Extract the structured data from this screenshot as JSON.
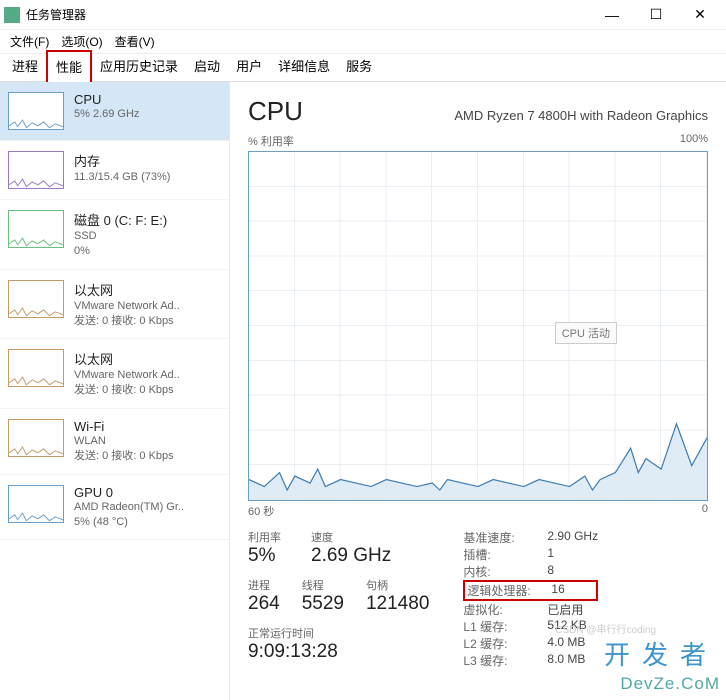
{
  "window": {
    "title": "任务管理器"
  },
  "menu": {
    "file": "文件(F)",
    "options": "选项(O)",
    "view": "查看(V)"
  },
  "tabs": {
    "items": [
      "进程",
      "性能",
      "应用历史记录",
      "启动",
      "用户",
      "详细信息",
      "服务"
    ],
    "active_index": 1
  },
  "sidebar": [
    {
      "name": "CPU",
      "sub1": "5% 2.69 GHz",
      "sub2": "",
      "thumb_color": "#6aa0c8",
      "selected": true
    },
    {
      "name": "内存",
      "sub1": "11.3/15.4 GB (73%)",
      "sub2": "",
      "thumb_color": "#9b79c5",
      "selected": false
    },
    {
      "name": "磁盘 0 (C: F: E:)",
      "sub1": "SSD",
      "sub2": "0%",
      "thumb_color": "#6bbf7a",
      "selected": false
    },
    {
      "name": "以太网",
      "sub1": "VMware Network Ad..",
      "sub2": "发送: 0 接收: 0 Kbps",
      "thumb_color": "#c69a6b",
      "selected": false
    },
    {
      "name": "以太网",
      "sub1": "VMware Network Ad..",
      "sub2": "发送: 0 接收: 0 Kbps",
      "thumb_color": "#c69a6b",
      "selected": false
    },
    {
      "name": "Wi-Fi",
      "sub1": "WLAN",
      "sub2": "发送: 0 接收: 0 Kbps",
      "thumb_color": "#c69a6b",
      "selected": false
    },
    {
      "name": "GPU 0",
      "sub1": "AMD Radeon(TM) Gr..",
      "sub2": "5% (48 °C)",
      "thumb_color": "#6aa0c8",
      "selected": false
    }
  ],
  "main": {
    "title": "CPU",
    "subtitle": "AMD Ryzen 7 4800H with Radeon Graphics",
    "axis_top_left": "% 利用率",
    "axis_top_right": "100%",
    "axis_bottom_left": "60 秒",
    "axis_bottom_right": "0",
    "chart_annotation": "CPU 活动",
    "stats_left": [
      {
        "label": "利用率",
        "value": "5%"
      },
      {
        "label": "速度",
        "value": "2.69 GHz"
      }
    ],
    "stats_mid": [
      {
        "label": "进程",
        "value": "264"
      },
      {
        "label": "线程",
        "value": "5529"
      },
      {
        "label": "句柄",
        "value": "121480"
      }
    ],
    "uptime_label": "正常运行时间",
    "uptime_value": "9:09:13:28",
    "stats_right": [
      {
        "k": "基准速度:",
        "v": "2.90 GHz"
      },
      {
        "k": "插槽:",
        "v": "1"
      },
      {
        "k": "内核:",
        "v": "8"
      },
      {
        "k": "逻辑处理器:",
        "v": "16",
        "hl": true
      },
      {
        "k": "虚拟化:",
        "v": "已启用"
      },
      {
        "k": "L1 缓存:",
        "v": "512 KB"
      },
      {
        "k": "L2 缓存:",
        "v": "4.0 MB"
      },
      {
        "k": "L3 缓存:",
        "v": "8.0 MB"
      }
    ]
  },
  "chart_data": {
    "type": "area",
    "title": "CPU 活动",
    "xlabel": "60 秒",
    "ylabel": "% 利用率",
    "xlim": [
      0,
      60
    ],
    "ylim": [
      0,
      100
    ],
    "x": [
      0,
      2,
      4,
      5,
      6,
      8,
      9,
      10,
      12,
      14,
      16,
      18,
      20,
      22,
      24,
      25,
      26,
      28,
      30,
      32,
      34,
      36,
      38,
      40,
      42,
      44,
      45,
      46,
      48,
      50,
      51,
      52,
      54,
      56,
      58,
      60
    ],
    "values": [
      6,
      4,
      8,
      3,
      7,
      5,
      9,
      4,
      6,
      5,
      4,
      6,
      5,
      4,
      5,
      3,
      6,
      5,
      4,
      6,
      5,
      4,
      6,
      5,
      4,
      7,
      3,
      6,
      8,
      15,
      8,
      12,
      9,
      22,
      10,
      18
    ]
  },
  "watermark": {
    "big": "开发者",
    "url": "DevZe.CoM",
    "ghost": "CSDN @串行行coding"
  }
}
